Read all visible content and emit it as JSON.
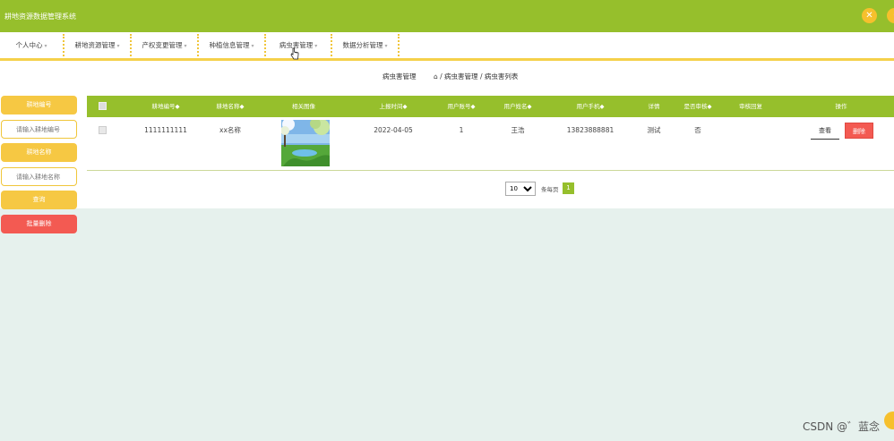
{
  "app": {
    "title": "耕地资源数据管理系统"
  },
  "nav": {
    "items": [
      {
        "label": "个人中心"
      },
      {
        "label": "耕地资源管理"
      },
      {
        "label": "产权变更管理"
      },
      {
        "label": "种植信息管理"
      },
      {
        "label": "病虫害管理"
      },
      {
        "label": "数据分析管理"
      }
    ],
    "caret": "▾"
  },
  "breadcrumb": {
    "title": "病虫害管理",
    "path": "⌂ / 病虫害管理 / 病虫害列表"
  },
  "search": {
    "field1_label": "耕地编号",
    "field1_placeholder": "请输入耕地编号",
    "field2_label": "耕地名称",
    "field2_placeholder": "请输入耕地名称",
    "query_label": "查询",
    "batch_delete_label": "批量删除"
  },
  "table": {
    "headers": [
      "耕地编号◆",
      "耕地名称◆",
      "相关图像",
      "上报时间◆",
      "用户账号◆",
      "用户姓名◆",
      "用户手机◆",
      "详情",
      "是否审核◆",
      "审核回复",
      "操作"
    ],
    "rows": [
      {
        "code": "1111111111",
        "name": "xx名称",
        "date": "2022-04-05",
        "account": "1",
        "username": "王浩",
        "phone": "13823888881",
        "detail": "测试",
        "reviewed": "否",
        "reply": "",
        "view_label": "查看",
        "delete_label": "删除"
      }
    ]
  },
  "pagination": {
    "page_size": "10",
    "per_page_label": "条每页",
    "current_page": "1"
  },
  "watermark": "CSDN @゛蓝念",
  "colors": {
    "primary": "#96bf2c",
    "accent": "#f6c843",
    "danger": "#f35a52"
  }
}
